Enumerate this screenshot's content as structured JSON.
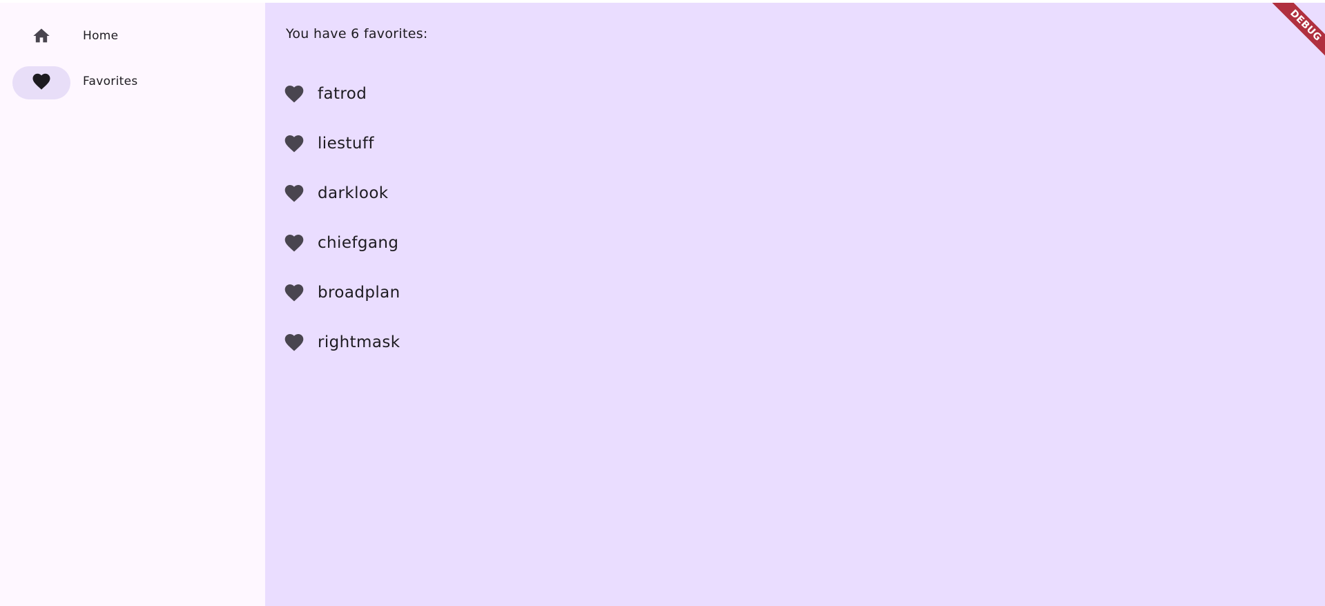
{
  "nav": {
    "items": [
      {
        "label": "Home",
        "icon": "home-icon",
        "selected": false
      },
      {
        "label": "Favorites",
        "icon": "heart-icon",
        "selected": true
      }
    ]
  },
  "main": {
    "count_text": "You have 6 favorites:",
    "favorites": [
      {
        "label": "fatrod",
        "icon": "heart-icon"
      },
      {
        "label": "liestuff",
        "icon": "heart-icon"
      },
      {
        "label": "darklook",
        "icon": "heart-icon"
      },
      {
        "label": "chiefgang",
        "icon": "heart-icon"
      },
      {
        "label": "broadplan",
        "icon": "heart-icon"
      },
      {
        "label": "rightmask",
        "icon": "heart-icon"
      }
    ]
  },
  "debug_banner": {
    "label": "DEBUG"
  },
  "colors": {
    "nav_background": "#fef7ff",
    "main_background": "#eaddff",
    "selected_indicator": "#e8def8",
    "icon": "#49454f",
    "text": "#1d1b20",
    "debug_banner": "#b0303f"
  }
}
